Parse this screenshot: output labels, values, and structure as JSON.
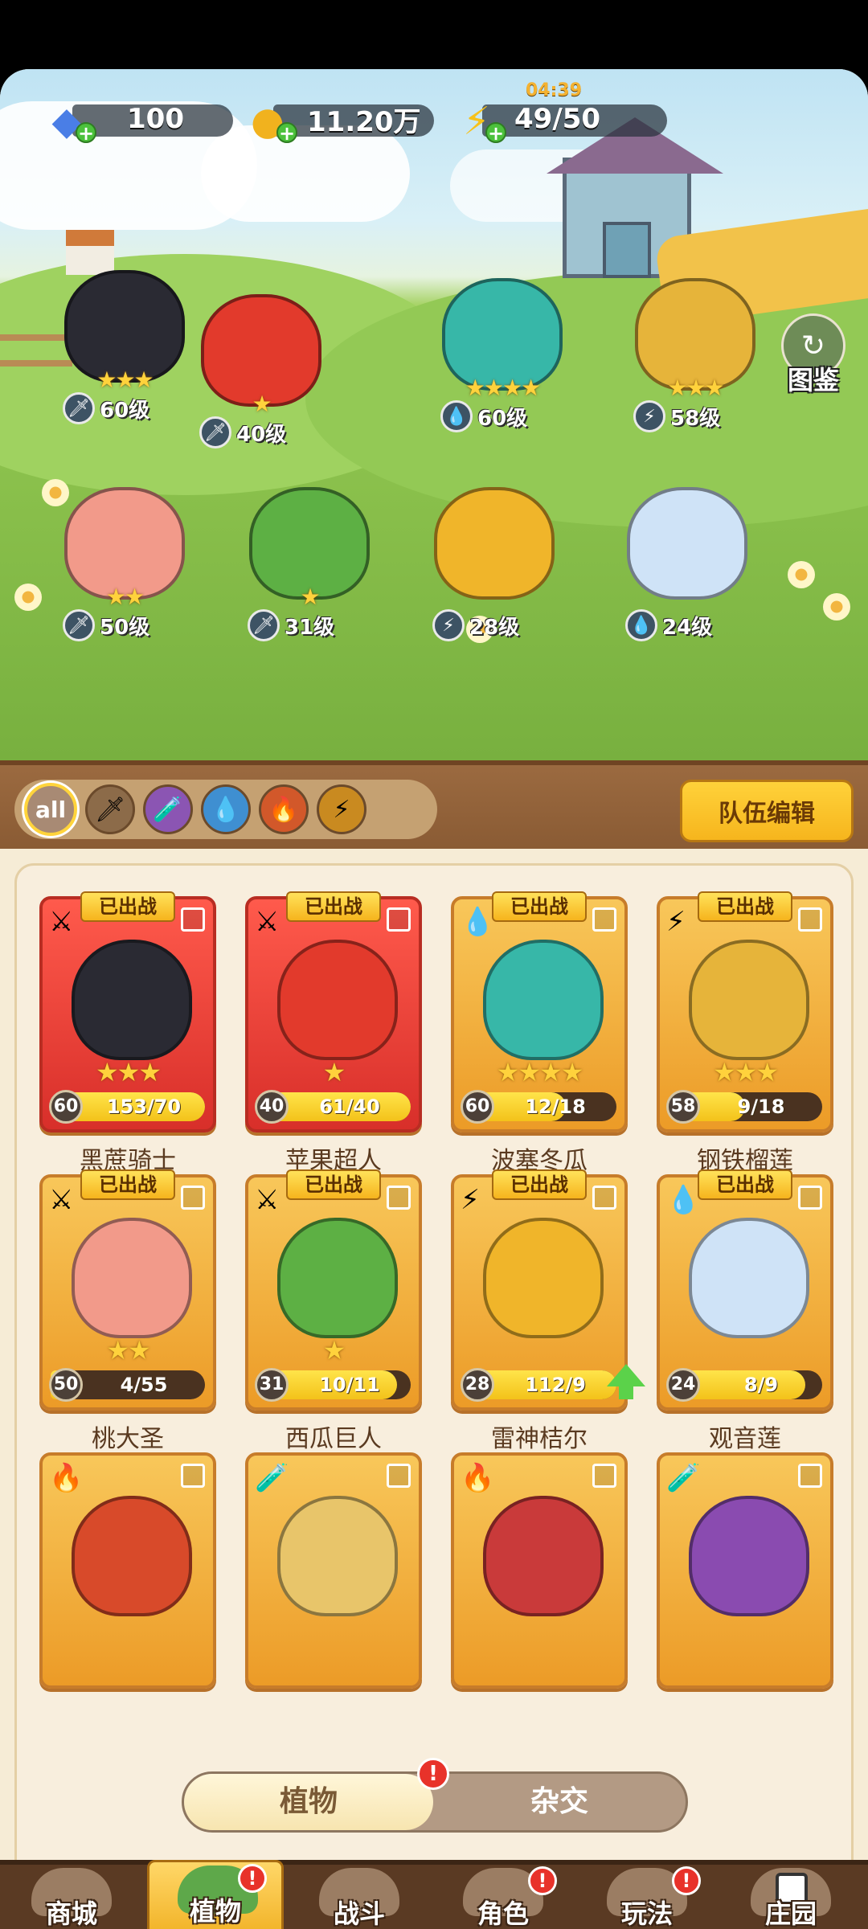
{
  "resources": {
    "gems": "100",
    "coins": "11.20万",
    "energy": "49/50",
    "energy_timer": "04:39"
  },
  "codex_label": "图鉴",
  "team_heroes": [
    {
      "level": "60级",
      "stars": "★★★",
      "element": "sword",
      "color": "#2a2a33"
    },
    {
      "level": "40级",
      "stars": "★",
      "element": "sword",
      "color": "#e23a2c"
    },
    {
      "level": "60级",
      "stars": "★★★★",
      "element": "water",
      "color": "#37b7a8"
    },
    {
      "level": "58级",
      "stars": "★★★",
      "element": "lightning",
      "color": "#e6b43a"
    },
    {
      "level": "50级",
      "stars": "★★",
      "element": "sword",
      "color": "#f29a8a"
    },
    {
      "level": "31级",
      "stars": "★",
      "element": "sword",
      "color": "#5db044"
    },
    {
      "level": "28级",
      "stars": "",
      "element": "lightning",
      "color": "#f0b52a"
    },
    {
      "level": "24级",
      "stars": "",
      "element": "water",
      "color": "#cfe3f7"
    }
  ],
  "filters": [
    "all",
    "sword",
    "poison",
    "water",
    "fire",
    "lightning"
  ],
  "team_edit_label": "队伍编辑",
  "deployed_label": "已出战",
  "cards": [
    {
      "name": "黑蔗骑士",
      "level": "60",
      "progress": "153/70",
      "fill": 1.0,
      "stars": "★★★",
      "element": "⚔",
      "deployed": true,
      "red": true,
      "color": "#2a2a33"
    },
    {
      "name": "苹果超人",
      "level": "40",
      "progress": "61/40",
      "fill": 1.0,
      "stars": "★",
      "element": "⚔",
      "deployed": true,
      "red": true,
      "color": "#e23a2c"
    },
    {
      "name": "波塞冬瓜",
      "level": "60",
      "progress": "12/18",
      "fill": 0.67,
      "stars": "★★★★",
      "element": "💧",
      "deployed": true,
      "red": false,
      "color": "#37b7a8"
    },
    {
      "name": "钢铁榴莲",
      "level": "58",
      "progress": "9/18",
      "fill": 0.5,
      "stars": "★★★",
      "element": "⚡",
      "deployed": true,
      "red": false,
      "color": "#e6b43a"
    },
    {
      "name": "桃大圣",
      "level": "50",
      "progress": "4/55",
      "fill": 0.07,
      "stars": "★★",
      "element": "⚔",
      "deployed": true,
      "red": false,
      "color": "#f29a8a"
    },
    {
      "name": "西瓜巨人",
      "level": "31",
      "progress": "10/11",
      "fill": 0.91,
      "stars": "★",
      "element": "⚔",
      "deployed": true,
      "red": false,
      "color": "#5db044"
    },
    {
      "name": "雷神桔尔",
      "level": "28",
      "progress": "112/9",
      "fill": 1.0,
      "stars": "",
      "element": "⚡",
      "deployed": true,
      "red": false,
      "color": "#f0b52a",
      "upgrade": true
    },
    {
      "name": "观音莲",
      "level": "24",
      "progress": "8/9",
      "fill": 0.89,
      "stars": "",
      "element": "💧",
      "deployed": true,
      "red": false,
      "color": "#cfe3f7"
    },
    {
      "name": "",
      "element": "🔥",
      "color": "#d84a2a"
    },
    {
      "name": "",
      "element": "🧪",
      "color": "#e8c56a"
    },
    {
      "name": "",
      "element": "🔥",
      "color": "#c93a3a"
    },
    {
      "name": "",
      "element": "🧪",
      "color": "#8a4bb0"
    }
  ],
  "toggle": {
    "on": "植物",
    "off": "杂交",
    "alert": "!"
  },
  "nav": [
    {
      "label": "商城",
      "active": false,
      "alert": false,
      "locked": false
    },
    {
      "label": "植物",
      "active": true,
      "alert": true,
      "locked": false
    },
    {
      "label": "战斗",
      "active": false,
      "alert": false,
      "locked": false
    },
    {
      "label": "角色",
      "active": false,
      "alert": true,
      "locked": false
    },
    {
      "label": "玩法",
      "active": false,
      "alert": true,
      "locked": false
    },
    {
      "label": "庄园",
      "active": false,
      "alert": false,
      "locked": true
    }
  ]
}
